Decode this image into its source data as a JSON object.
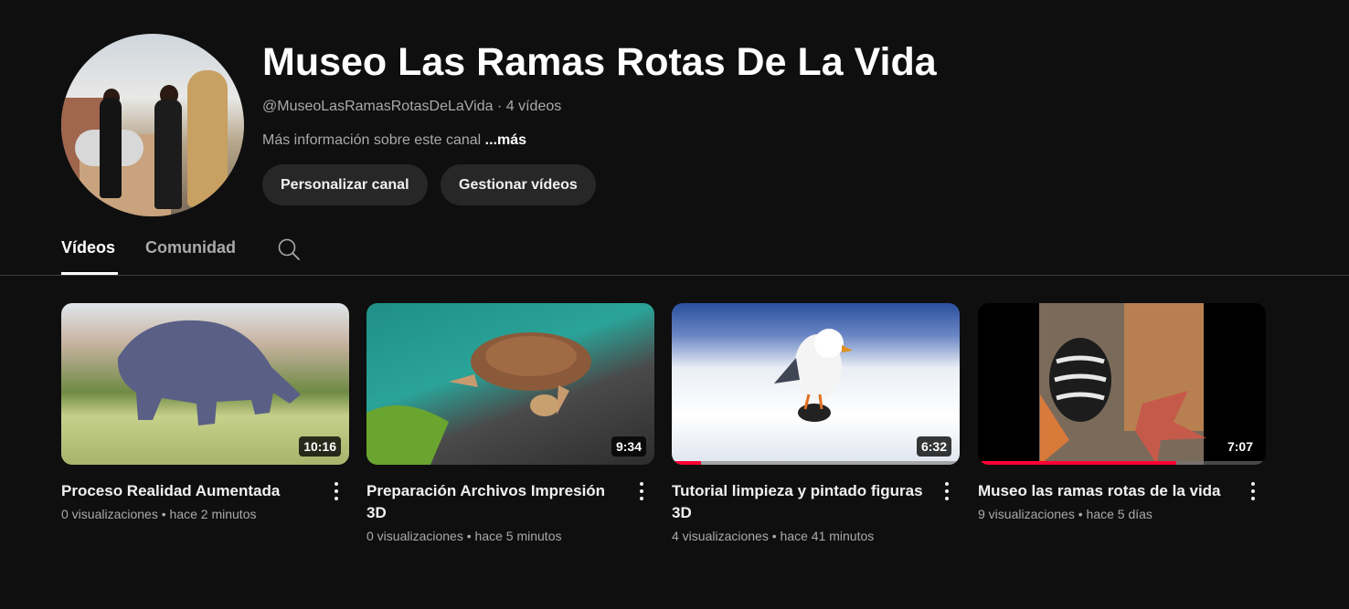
{
  "channel": {
    "name": "Museo Las Ramas Rotas De La Vida",
    "handle": "@MuseoLasRamasRotasDeLaVida",
    "separator": " · ",
    "video_count": "4 vídeos",
    "description": "Más información sobre este canal ",
    "more_label": "...más"
  },
  "buttons": {
    "customize": "Personalizar canal",
    "manage": "Gestionar vídeos"
  },
  "tabs": [
    {
      "label": "Vídeos",
      "active": true
    },
    {
      "label": "Comunidad",
      "active": false
    }
  ],
  "icons": {
    "search": "search-icon",
    "more": "more-vert-icon"
  },
  "colors": {
    "background": "#0f0f0f",
    "button_bg": "#272727",
    "progress": "#ff0033",
    "secondary_text": "#aaaaaa"
  },
  "videos": [
    {
      "title": "Proceso Realidad Aumentada",
      "duration": "10:16",
      "views": "0 visualizaciones",
      "age": "hace 2 minutos",
      "watched_fraction": 0
    },
    {
      "title": "Preparación Archivos Impresión 3D",
      "duration": "9:34",
      "views": "0 visualizaciones",
      "age": "hace 5 minutos",
      "watched_fraction": 0
    },
    {
      "title": "Tutorial limpieza y pintado figuras 3D",
      "duration": "6:32",
      "views": "4 visualizaciones",
      "age": "hace 41 minutos",
      "watched_fraction": 0.1
    },
    {
      "title": "Museo las ramas rotas de la vida",
      "duration": "7:07",
      "views": "9 visualizaciones",
      "age": "hace 5 días",
      "watched_fraction": 0.69
    }
  ]
}
